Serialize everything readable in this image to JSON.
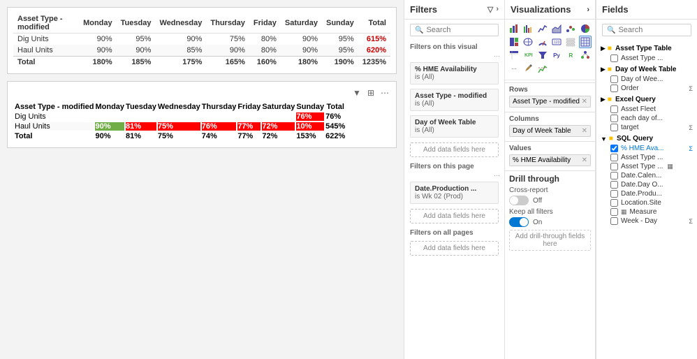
{
  "main": {
    "table1": {
      "columns": [
        "Asset Type - modified",
        "Monday",
        "Tuesday",
        "Wednesday",
        "Thursday",
        "Friday",
        "Saturday",
        "Sunday",
        "Total"
      ],
      "rows": [
        [
          "Dig Units",
          "90%",
          "95%",
          "90%",
          "75%",
          "80%",
          "90%",
          "95%",
          "615%"
        ],
        [
          "Haul Units",
          "90%",
          "90%",
          "85%",
          "90%",
          "80%",
          "90%",
          "95%",
          "620%"
        ]
      ],
      "total_row": [
        "Total",
        "180%",
        "185%",
        "175%",
        "165%",
        "160%",
        "180%",
        "190%",
        "1235%"
      ]
    },
    "table2": {
      "toolbar_icons": [
        "filter",
        "fit",
        "more"
      ],
      "columns": [
        "Asset Type - modified",
        "Monday",
        "Tuesday",
        "Wednesday",
        "Thursday",
        "Friday",
        "Saturday",
        "Sunday",
        "Total"
      ],
      "rows": [
        {
          "cells": [
            "Dig Units",
            "",
            "",
            "",
            "",
            "",
            "",
            "76%",
            "76%"
          ],
          "colors": [
            null,
            null,
            null,
            null,
            null,
            null,
            null,
            "red",
            null
          ]
        },
        {
          "cells": [
            "Haul Units",
            "90%",
            "81%",
            "75%",
            "76%",
            "77%",
            "72%",
            "10%",
            "545%"
          ],
          "colors": [
            null,
            "green",
            "red",
            "red",
            "red",
            "red",
            "red",
            "red",
            null
          ]
        }
      ],
      "total_row": [
        "Total",
        "90%",
        "81%",
        "75%",
        "74%",
        "77%",
        "72%",
        "153%",
        "622%"
      ]
    }
  },
  "filters": {
    "title": "Filters",
    "search_placeholder": "Search",
    "section_visual": "Filters on this visual",
    "item1_name": "% HME Availability",
    "item1_value": "is (All)",
    "item2_name": "Asset Type - modified",
    "item2_value": "is (All)",
    "item3_name": "Day of Week Table",
    "item3_value": "is (All)",
    "add_data_label": "Add data fields here",
    "section_page": "Filters on this page",
    "item4_name": "Date.Production ...",
    "item4_value": "is Wk 02 (Prod)",
    "add_data_label2": "Add data fields here",
    "section_all": "Filters on all pages",
    "add_data_label3": "Add data fields here"
  },
  "visualizations": {
    "title": "Visualizations",
    "rows_label": "Rows",
    "rows_field": "Asset Type - modified",
    "columns_label": "Columns",
    "columns_field": "Day of Week Table",
    "values_label": "Values",
    "values_field": "% HME Availability",
    "add_fields": "Add data fields here",
    "drill_title": "Drill through",
    "cross_report_label": "Cross-report",
    "cross_report_state": "Off",
    "keep_filters_label": "Keep all filters",
    "keep_filters_state": "On",
    "add_drill_label": "Add drill-through fields here"
  },
  "fields": {
    "title": "Fields",
    "search_placeholder": "Search",
    "groups": [
      {
        "name": "Asset Type Table",
        "icon": "table",
        "items": [
          {
            "label": "Asset Type ...",
            "type": "field",
            "checked": false
          }
        ]
      },
      {
        "name": "Day of Week Table",
        "icon": "table",
        "items": [
          {
            "label": "Day of Wee...",
            "type": "field",
            "checked": false
          },
          {
            "label": "Order",
            "type": "sigma",
            "checked": false
          }
        ]
      },
      {
        "name": "Excel Query",
        "icon": "table",
        "items": [
          {
            "label": "Asset Fleet",
            "type": "field",
            "checked": false
          },
          {
            "label": "each day of...",
            "type": "field",
            "checked": false
          },
          {
            "label": "target",
            "type": "sigma",
            "checked": false
          }
        ]
      },
      {
        "name": "SQL Query",
        "icon": "table",
        "items": [
          {
            "label": "% HME Ava...",
            "type": "sigma",
            "checked": true
          },
          {
            "label": "Asset Type ...",
            "type": "field",
            "checked": false
          },
          {
            "label": "Asset Type ...",
            "type": "field",
            "checked": false
          },
          {
            "label": "Date.Calen...",
            "type": "field",
            "checked": false
          },
          {
            "label": "Date.Day O...",
            "type": "field",
            "checked": false
          },
          {
            "label": "Date.Produ...",
            "type": "field",
            "checked": false
          },
          {
            "label": "Location.Site",
            "type": "field",
            "checked": false
          },
          {
            "label": "Measure",
            "type": "table",
            "checked": false
          },
          {
            "label": "Week - Day",
            "type": "sigma",
            "checked": false
          }
        ]
      }
    ]
  }
}
